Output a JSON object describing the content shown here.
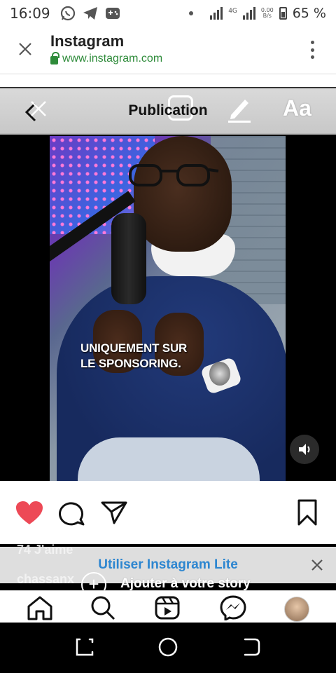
{
  "status_bar": {
    "time": "16:09",
    "left_icons": [
      "whatsapp-icon",
      "telegram-icon",
      "gamepad-icon"
    ],
    "network_4g": "4G",
    "network_speed_top": "0.00",
    "network_speed_bottom": "B/s",
    "battery": "65 %"
  },
  "browser": {
    "title": "Instagram",
    "url": "www.instagram.com"
  },
  "post_header": {
    "title": "Publication"
  },
  "story_tools": {
    "text_tool": "Aa"
  },
  "video": {
    "caption_line1": "UNIQUEMENT SUR",
    "caption_line2": "LE SPONSORING."
  },
  "actions": {
    "like_color": "#ed4956"
  },
  "post_meta": {
    "likes": "74 J'aime",
    "username": "chassanx"
  },
  "lite_banner": {
    "label": "Utiliser Instagram Lite"
  },
  "story_bar": {
    "label": "Ajouter à votre story"
  },
  "bottom_nav": {
    "items": [
      "home-icon",
      "search-icon",
      "reels-icon",
      "messenger-icon",
      "profile-avatar"
    ]
  },
  "colors": {
    "url_green": "#2e8b3a",
    "link_blue": "#2d86d0"
  }
}
